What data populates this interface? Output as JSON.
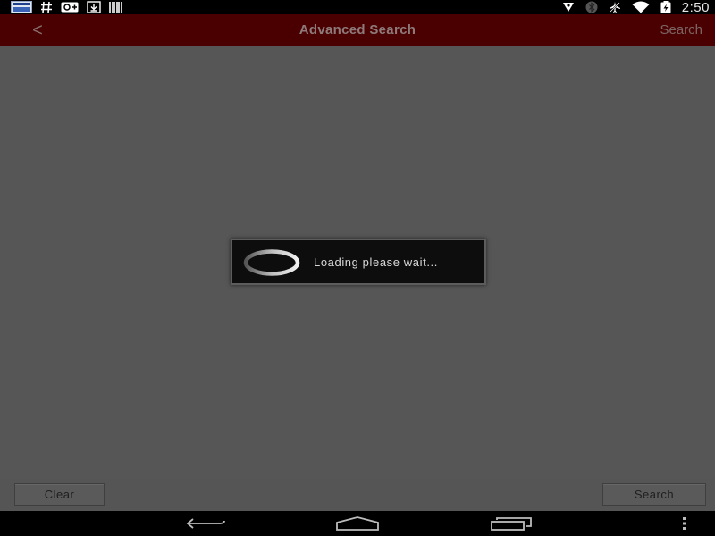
{
  "status_bar": {
    "time": "2:50",
    "left_icons": [
      "news-app-icon",
      "hashtag-icon",
      "google-plus-icon",
      "download-icon",
      "barcode-icon"
    ],
    "right_icons": [
      "location-icon",
      "bluetooth-icon",
      "airplane-icon",
      "wifi-icon",
      "battery-charging-icon"
    ]
  },
  "action_bar": {
    "back_label": "<",
    "title": "Advanced Search",
    "search_label": "Search",
    "background_color": "#4a0000"
  },
  "dialog": {
    "message": "Loading please wait..."
  },
  "footer": {
    "clear_label": "Clear",
    "search_label": "Search"
  },
  "nav_bar": {
    "buttons": [
      "back-icon",
      "home-icon",
      "recent-apps-icon",
      "overflow-menu-icon"
    ]
  }
}
